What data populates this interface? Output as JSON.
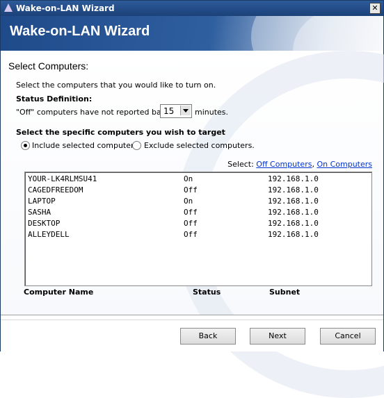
{
  "window": {
    "title": "Wake-on-LAN Wizard",
    "close_glyph": "✕"
  },
  "banner": {
    "heading": "Wake-on-LAN Wizard"
  },
  "page": {
    "section_title": "Select Computers:",
    "instruction": "Select the computers that you would like to turn on.",
    "status_definition_label": "Status Definition:",
    "offline_text": "\"Off\" computers have not reported back in",
    "minutes_value": "15",
    "minutes_label": "minutes.",
    "target_title": "Select the specific computers you wish to target",
    "radio_include_label": "Include selected computers.",
    "radio_exclude_label": "Exclude selected computers.",
    "selected_option": "include",
    "select_prefix": "Select:",
    "select_off_link": "Off Computers",
    "select_separator": ",",
    "select_on_link": "On Computers"
  },
  "computers": [
    {
      "name": "YOUR-LK4RLMSU41",
      "status": "On",
      "subnet": "192.168.1.0"
    },
    {
      "name": "CAGEDFREEDOM",
      "status": "Off",
      "subnet": "192.168.1.0"
    },
    {
      "name": "LAPTOP",
      "status": "On",
      "subnet": "192.168.1.0"
    },
    {
      "name": "SASHA",
      "status": "Off",
      "subnet": "192.168.1.0"
    },
    {
      "name": "DESKTOP",
      "status": "Off",
      "subnet": "192.168.1.0"
    },
    {
      "name": "ALLEYDELL",
      "status": "Off",
      "subnet": "192.168.1.0"
    }
  ],
  "columns": {
    "name": "Computer Name",
    "status": "Status",
    "subnet": "Subnet"
  },
  "buttons": {
    "back": "Back",
    "next": "Next",
    "cancel": "Cancel"
  }
}
